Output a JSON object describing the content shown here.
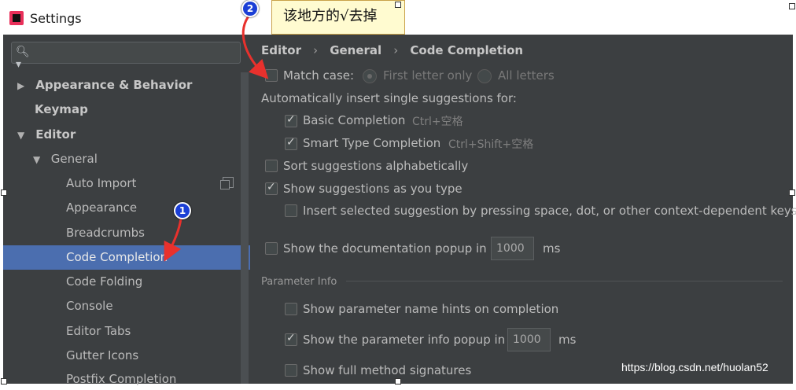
{
  "window": {
    "title": "Settings"
  },
  "sidebar": {
    "items": [
      {
        "label": "Appearance & Behavior",
        "arrow": "▶"
      },
      {
        "label": "Keymap"
      },
      {
        "label": "Editor",
        "arrow": "▼"
      },
      {
        "label": "General",
        "arrow": "▼"
      },
      {
        "label": "Auto Import"
      },
      {
        "label": "Appearance"
      },
      {
        "label": "Breadcrumbs"
      },
      {
        "label": "Code Completion"
      },
      {
        "label": "Code Folding"
      },
      {
        "label": "Console"
      },
      {
        "label": "Editor Tabs"
      },
      {
        "label": "Gutter Icons"
      },
      {
        "label": "Postfix Completion"
      }
    ]
  },
  "breadcrumb": {
    "items": [
      "Editor",
      "General",
      "Code Completion"
    ],
    "separator": "›"
  },
  "options": {
    "match_case": "Match case:",
    "first_letter_only": "First letter only",
    "all_letters": "All letters",
    "auto_insert_heading": "Automatically insert single suggestions for:",
    "basic_completion": "Basic Completion",
    "basic_shortcut": "Ctrl+空格",
    "smart_type": "Smart Type Completion",
    "smart_shortcut": "Ctrl+Shift+空格",
    "sort_alpha": "Sort suggestions alphabetically",
    "show_as_type": "Show suggestions as you type",
    "insert_selected": "Insert selected suggestion by pressing space, dot, or other context-dependent keys",
    "doc_popup": "Show the documentation popup in",
    "doc_popup_value": "1000",
    "ms": "ms",
    "param_info_section": "Parameter Info",
    "param_hints": "Show parameter name hints on completion",
    "param_popup": "Show the parameter info popup in",
    "param_popup_value": "1000",
    "full_signatures": "Show full method signatures"
  },
  "annotations": {
    "note": "该地方的√去掉",
    "badge_1": "1",
    "badge_2": "2"
  },
  "watermark": "https://blog.csdn.net/huolan52",
  "colors": {
    "accent_selection": "#4b6eaf",
    "panel_bg": "#3c3f41",
    "callout_red": "#e8312d",
    "badge_blue": "#1b3fd6"
  }
}
